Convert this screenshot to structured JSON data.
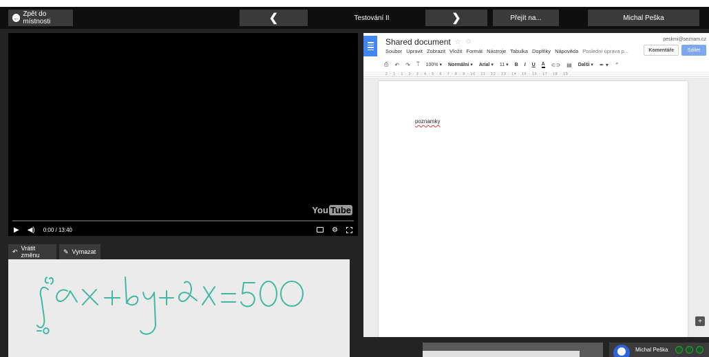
{
  "nav": {
    "back_label": "Zpět do místnosti",
    "prev_glyph": "❮",
    "room_title": "Testování II",
    "next_glyph": "❯",
    "goto_label": "Přejít na...",
    "user_label": "Michal Peška"
  },
  "video": {
    "time": "0:00 / 13:40",
    "progress": 0.0,
    "logo_you": "You",
    "logo_tube": "Tube"
  },
  "whiteboard": {
    "undo_label": "Vrátit změnu",
    "clear_label": "Vymazat",
    "stroke_color": "#3fb8a0"
  },
  "doc": {
    "title": "Shared document",
    "email": "peskmi@seznam.cz",
    "menus": [
      "Soubor",
      "Upravit",
      "Zobrazit",
      "Vložit",
      "Formát",
      "Nástroje",
      "Tabulka",
      "Doplňky",
      "Nápověda"
    ],
    "last_edit": "Poslední úprava p...",
    "comments_label": "Komentáře",
    "share_label": "Sdílet",
    "zoom": "100%",
    "style": "Normální",
    "font": "Arial",
    "font_size": "11",
    "more_label": "Další",
    "ruler": "2 · 1 · 1 · 2 · 3 · 4 · 5 · 6 · 7 · 8 · 9 · 10 · 11 · 12 · 13 · 14 · 15 · 16 · 17 · 18 · 19",
    "body_text": "poznamky",
    "accent": "#4285f4"
  },
  "participant": {
    "name": "Michal Peška"
  }
}
